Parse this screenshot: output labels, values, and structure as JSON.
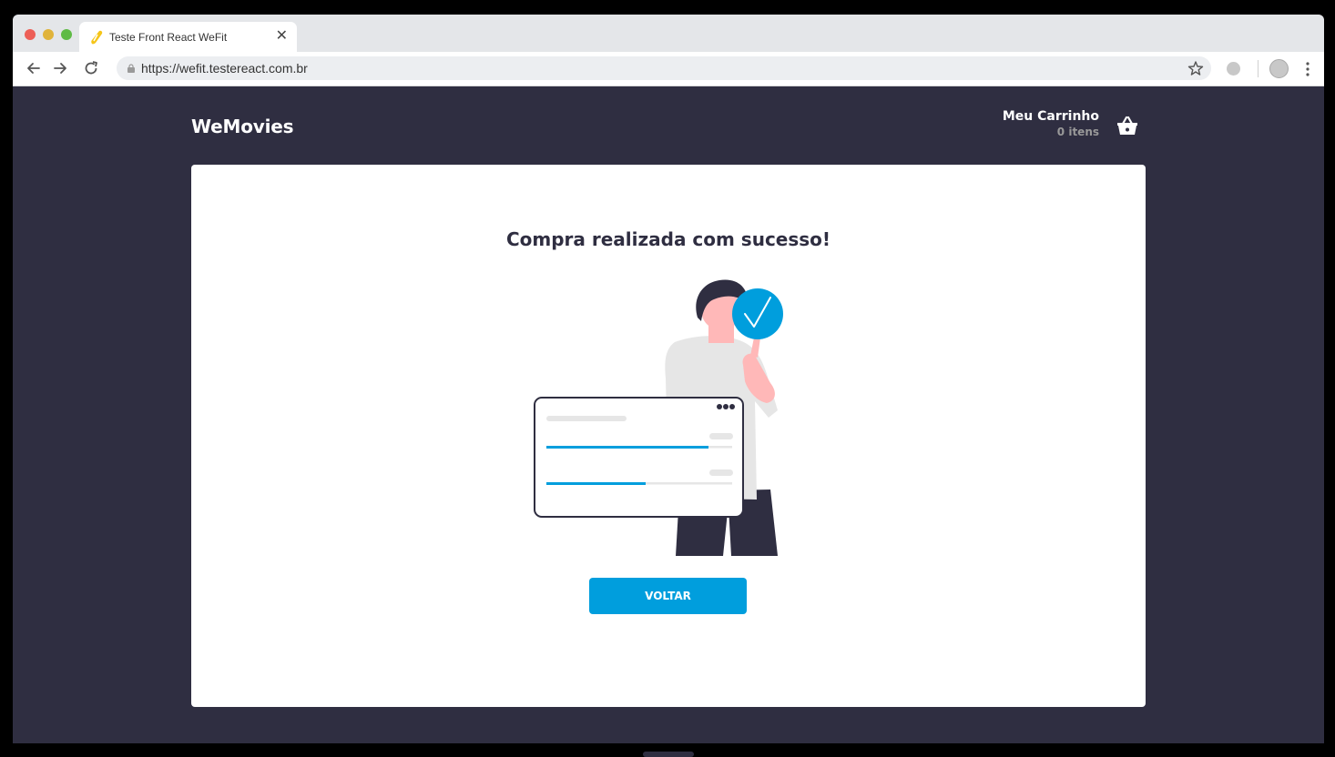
{
  "browser": {
    "tab_title": "Teste Front React WeFit",
    "tab_close": "✕",
    "url": "https://wefit.testereact.com.br"
  },
  "header": {
    "brand": "WeMovies",
    "cart_title": "Meu Carrinho",
    "cart_count": "0 itens"
  },
  "content": {
    "headline": "Compra realizada com sucesso!",
    "back_button": "VOLTAR"
  },
  "icons": {
    "favicon": "pencil-favicon-icon",
    "back": "arrow-left-icon",
    "forward": "arrow-right-icon",
    "reload": "reload-icon",
    "lock": "lock-icon",
    "bookmark": "star-icon",
    "menu": "kebab-menu-icon",
    "cart": "basket-icon",
    "success": "check-circle-icon"
  },
  "colors": {
    "page_background": "#2f2e41",
    "accent": "#009edd",
    "card_background": "#ffffff"
  }
}
